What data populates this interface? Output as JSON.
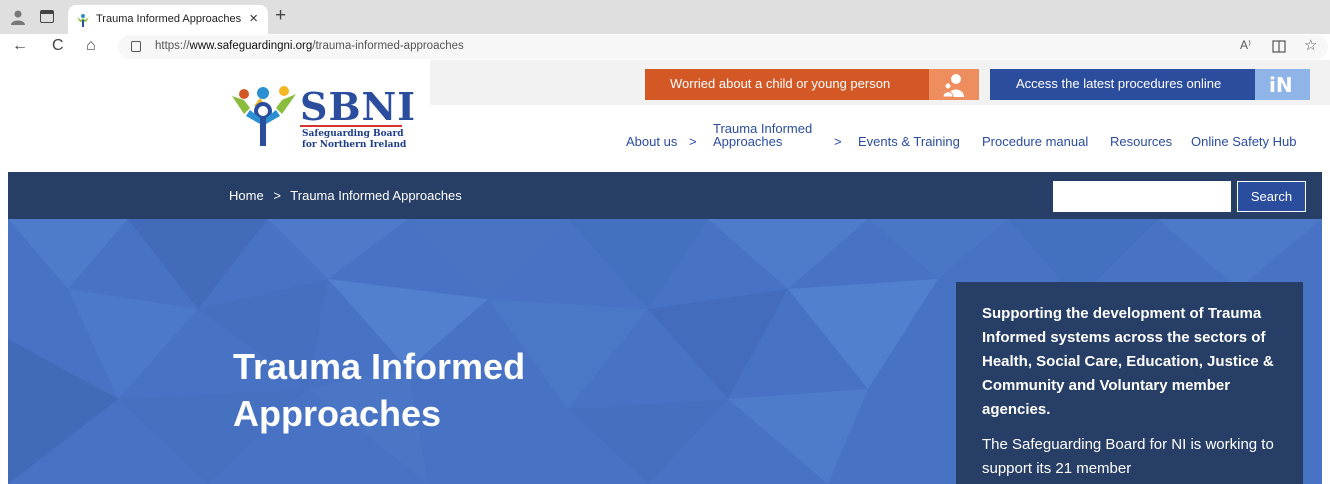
{
  "browser": {
    "tab_title": "Trauma Informed Approaches",
    "tab_close": "×",
    "new_tab": "+",
    "url_prefix": "https://",
    "url_domain": "www.safeguardingni.org",
    "url_path": "/trauma-informed-approaches",
    "read_aloud": "A⁾",
    "back": "←",
    "reload": "C",
    "home": "⌂",
    "favorite": "☆"
  },
  "logo": {
    "word": "SBNI",
    "sub1": "Safeguarding Board",
    "sub2": "for Northern Ireland"
  },
  "header": {
    "worried_label": "Worried about a child or young person",
    "access_label": "Access the latest procedures online",
    "access_icon_text": "iN"
  },
  "nav": {
    "about": "About us",
    "about_chevron": ">",
    "tia_line1": "Trauma Informed",
    "tia_line2": "Approaches",
    "tia_chevron": ">",
    "events": "Events & Training",
    "procedure": "Procedure manual",
    "resources": "Resources",
    "online_safety": "Online Safety Hub"
  },
  "breadcrumb": {
    "home": "Home",
    "separator": ">",
    "current": "Trauma Informed Approaches"
  },
  "search": {
    "placeholder": "",
    "button": "Search"
  },
  "hero": {
    "title_line1": "Trauma Informed",
    "title_line2": "Approaches",
    "panel_strong": "Supporting the development of Trauma Informed systems across the sectors of Health, Social Care, Education, Justice & Community and Voluntary member agencies.",
    "panel_text": "The Safeguarding Board for NI is working to support its 21 member"
  },
  "colors": {
    "brand_blue": "#2b4d9e",
    "dark_navy": "#273f66",
    "hero_blue": "#4873c4",
    "orange": "#d35826"
  }
}
